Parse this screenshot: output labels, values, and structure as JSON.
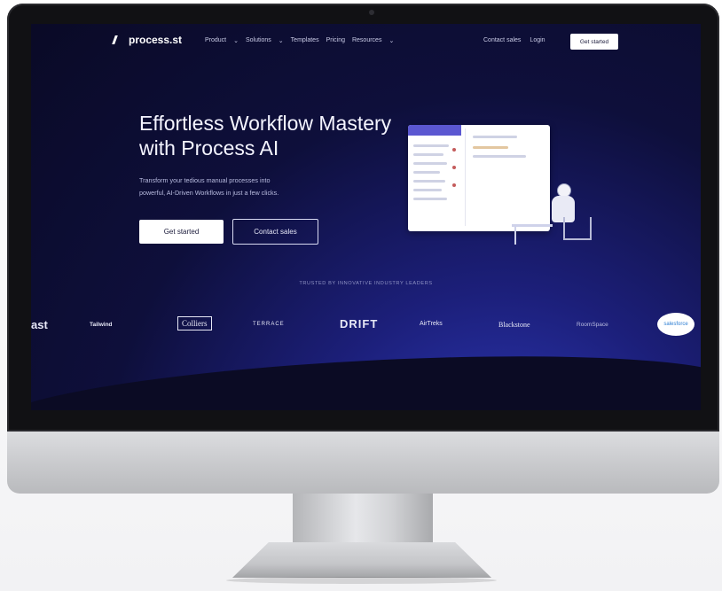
{
  "nav": {
    "logo_text": "process.st",
    "links": [
      "Product",
      "Solutions",
      "Templates",
      "Pricing",
      "Resources"
    ],
    "contact_sales": "Contact sales",
    "login": "Login",
    "cta": "Get started"
  },
  "hero": {
    "headline_line1": "Effortless Workflow Mastery",
    "headline_line2": "with Process AI",
    "sub_line1": "Transform your tedious manual processes into",
    "sub_line2": "powerful, AI-Driven Workflows in just a few clicks.",
    "primary_button": "Get started",
    "secondary_button": "Contact sales"
  },
  "trusted": {
    "label": "TRUSTED BY INNOVATIVE INDUSTRY LEADERS",
    "logos": [
      "ast",
      "Tailwind",
      "Colliers",
      "TERRACE",
      "DRIFT",
      "AirTreks",
      "Blackstone",
      "RoomSpace",
      "salesforce"
    ]
  },
  "colors": {
    "screen_bg": "#0e0f3b",
    "accent": "#5b57d1"
  }
}
